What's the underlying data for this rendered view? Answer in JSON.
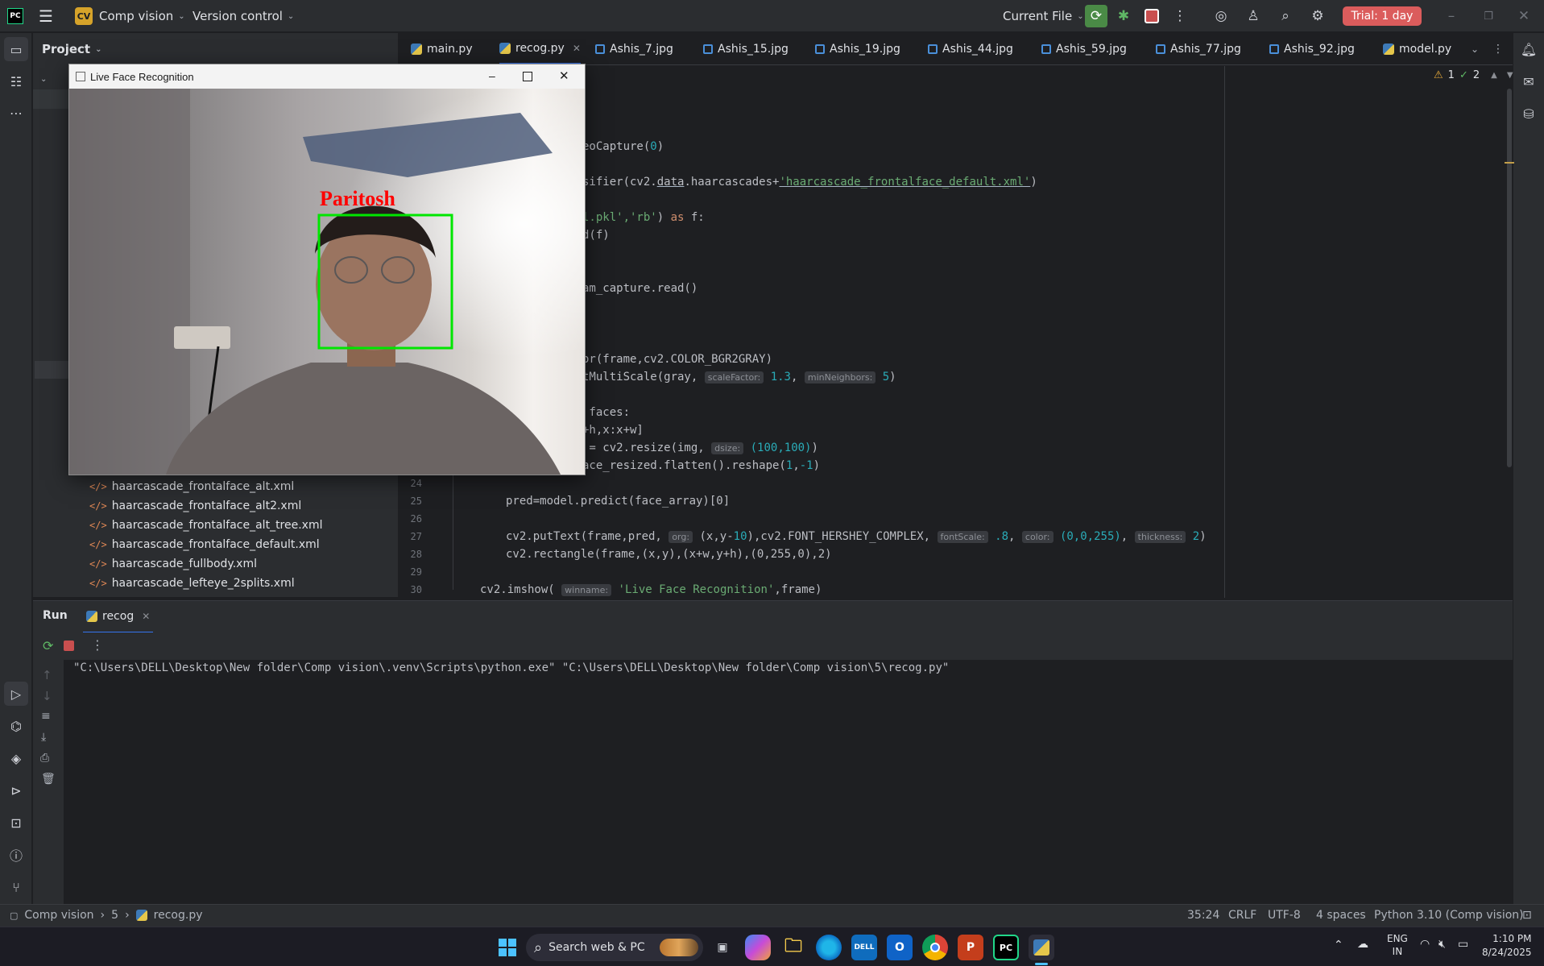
{
  "titlebar": {
    "project_badge": "CV",
    "project_name": "Comp vision",
    "vcs": "Version control",
    "run_config": "Current File",
    "trial": "Trial: 1 day"
  },
  "project_panel": {
    "header": "Project",
    "files": [
      "haarcascade_frontalface_alt.xml",
      "haarcascade_frontalface_alt2.xml",
      "haarcascade_frontalface_alt_tree.xml",
      "haarcascade_frontalface_default.xml",
      "haarcascade_fullbody.xml",
      "haarcascade_lefteye_2splits.xml"
    ],
    "file_tag": "</>"
  },
  "tabs": [
    {
      "label": "main.py",
      "type": "py"
    },
    {
      "label": "recog.py",
      "type": "py",
      "active": true
    },
    {
      "label": "Ashis_7.jpg",
      "type": "img"
    },
    {
      "label": "Ashis_15.jpg",
      "type": "img"
    },
    {
      "label": "Ashis_19.jpg",
      "type": "img"
    },
    {
      "label": "Ashis_44.jpg",
      "type": "img"
    },
    {
      "label": "Ashis_59.jpg",
      "type": "img"
    },
    {
      "label": "Ashis_77.jpg",
      "type": "img"
    },
    {
      "label": "Ashis_92.jpg",
      "type": "img"
    },
    {
      "label": "model.py",
      "type": "py"
    }
  ],
  "inspections": {
    "warnings": "1",
    "weak": "2"
  },
  "code": {
    "l_capture": "eoCapture(",
    "l_capture_arg": "0",
    "l_capture_end": ")",
    "l_cascade_pre": "sifier(cv2.",
    "l_cascade_data": "data",
    "l_cascade_mid": ".haarcascades+",
    "l_cascade_str": "'haarcascade_frontalface_default.xml'",
    "l_cascade_end": ")",
    "l_open_str": "l.pkl','rb'",
    "l_open_mid": ") ",
    "l_open_kw": "as",
    "l_open_end": " f:",
    "l_load": "d(f)",
    "l_read": "am_capture.read()",
    "l_cvt": "or(frame,cv2.COLOR_BGR2GRAY)",
    "l_detect_pre": "tMultiScale(gray,",
    "l_detect_hint1": "scaleFactor:",
    "l_detect_v1": "1.3",
    "l_detect_hint2": "minNeighbors:",
    "l_detect_v2": "5",
    "l_detect_end": ")",
    "l_for": " faces:",
    "l_slice": "+h,x:x+w]",
    "l_resize_pre": " = cv2.resize(img,",
    "l_resize_hint": "dsize:",
    "l_resize_v": "(100,100)",
    "l_resize_end": ")",
    "l_flat_pre": "ace_resized.flatten().reshape(",
    "l_flat_v1": "1",
    "l_flat_mid": ",",
    "l_flat_v2": "-1",
    "l_flat_end": ")",
    "l25": "pred=model.predict(face_array)[0]",
    "l27_pre": "cv2.putText(frame,pred,",
    "l27_h1": "org:",
    "l27_a": "(x,y-",
    "l27_n1": "10",
    "l27_b": "),cv2.FONT_HERSHEY_COMPLEX,",
    "l27_h2": "fontScale:",
    "l27_v2": ".8",
    "l27_h3": "color:",
    "l27_v3": "(0,0,255)",
    "l27_h4": "thickness:",
    "l27_v4": "2",
    "l27_end": ")",
    "l28": "cv2.rectangle(frame,(x,y),(x+w,y+h),(0,255,0),2)",
    "l30_pre": "cv2.imshow(",
    "l30_hint": "winname:",
    "l30_str": "'Live Face Recognition'",
    "l30_end": ",frame)",
    "line_numbers": [
      "24",
      "25",
      "26",
      "27",
      "28",
      "29",
      "30"
    ]
  },
  "run": {
    "tab_run": "Run",
    "tab_config": "recog",
    "console_line": "\"C:\\Users\\DELL\\Desktop\\New folder\\Comp vision\\.venv\\Scripts\\python.exe\" \"C:\\Users\\DELL\\Desktop\\New folder\\Comp vision\\5\\recog.py\""
  },
  "statusbar": {
    "crumb_project": "Comp vision",
    "crumb_dir": "5",
    "crumb_file": "recog.py",
    "position": "35:24",
    "line_sep": "CRLF",
    "encoding": "UTF-8",
    "indent": "4 spaces",
    "interpreter": "Python 3.10 (Comp vision)"
  },
  "window": {
    "title": "Live Face Recognition",
    "overlay_label": "Paritosh"
  },
  "taskbar": {
    "search": "Search web & PC",
    "lang": "ENG",
    "region": "IN",
    "time": "1:10 PM",
    "date": "8/24/2025"
  }
}
